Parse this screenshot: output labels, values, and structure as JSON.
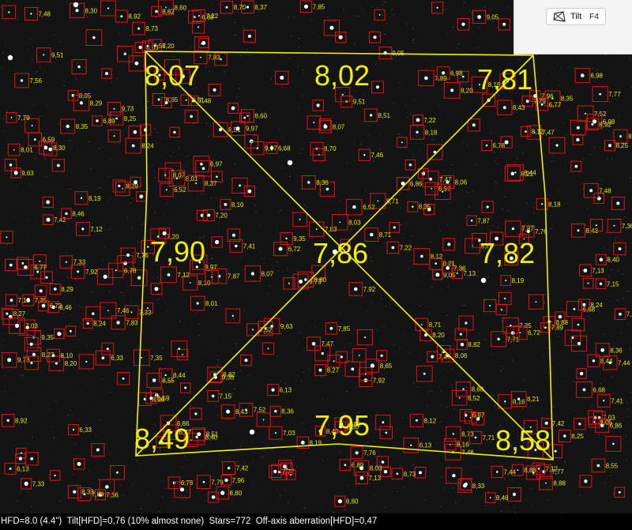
{
  "toolbar": {
    "tilt_button_label": "Tilt",
    "tilt_button_shortcut": "F4",
    "tilt_icon": "tilt-icon"
  },
  "analysis": {
    "corner_top_left": "8,07",
    "edge_top_center": "8,02",
    "corner_top_right": "7,81",
    "edge_middle_left": "7,90",
    "center": "7,86",
    "edge_middle_right": "7,82",
    "corner_bottom_left": "8,49",
    "edge_bottom_center": "7,95",
    "corner_bottom_right": "8,58"
  },
  "star_labels": [
    "8,07",
    "8,55",
    "6,97",
    "7,42",
    "8,71",
    "7,13",
    "8,65",
    "9,73",
    "7,48",
    "8,70",
    "6,72",
    "7,92",
    "8,25",
    "8,01",
    "8,21",
    "7,56",
    "8,36",
    "6,52",
    "7,52",
    "8,06",
    "8,73",
    "6,77",
    "8,60",
    "8,35",
    "7,15",
    "8,51",
    "8,46",
    "8,18",
    "7,87",
    "6,89",
    "8,82",
    "7,46",
    "7,83",
    "8,19",
    "9,05",
    "6,68",
    "7,79",
    "8,29",
    "8,88",
    "7,35",
    "8,12",
    "8,16",
    "8,24",
    "9,63",
    "8,20",
    "7,33",
    "8,92",
    "6,59",
    "7,36",
    "8,30",
    "7,76",
    "6,13",
    "8,27",
    "7,71",
    "8,40",
    "6,33",
    "7,77",
    "9,35",
    "8,03",
    "7,12",
    "6,86",
    "7,47",
    "8,10",
    "8,43",
    "7,41",
    "8,80",
    "7,89",
    "6,98",
    "7,22",
    "7,03",
    "8,37",
    "6,78",
    "8,44",
    "9,97",
    "9,51",
    "7,20",
    "8,33",
    "7,85",
    "7,44",
    "8,05",
    "7,96"
  ],
  "status": {
    "hfd": "HFD=8.0 (4.4\")",
    "tilt": "Tilt[HFD]=0,76 (10% almost none)",
    "stars": "Stars=772",
    "off_axis": "Off-axis aberration[HFD]=0,47"
  },
  "colors": {
    "overlay": "#f2f200",
    "star_box": "#e01515",
    "background": "#141414",
    "status_bar": "#000000"
  }
}
